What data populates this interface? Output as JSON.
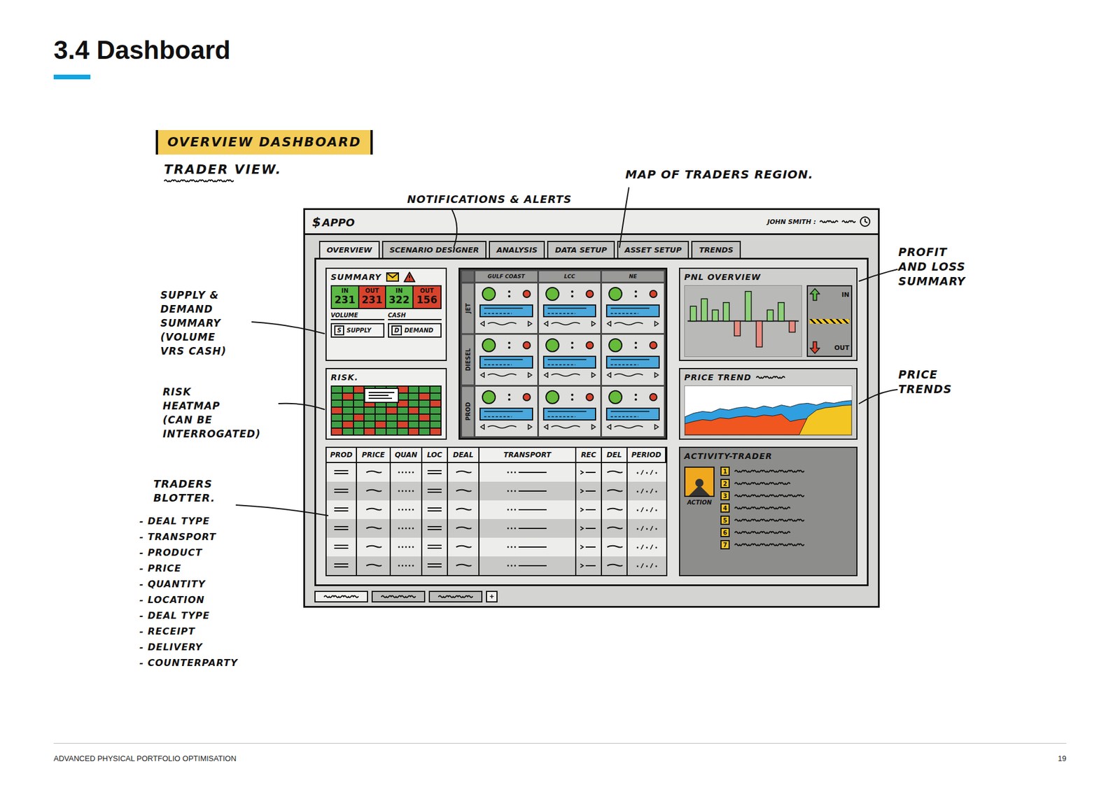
{
  "document": {
    "section_title": "3.4 Dashboard",
    "footer_title": "ADVANCED PHYSICAL PORTFOLIO OPTIMISATION",
    "page_number": "19"
  },
  "sketch": {
    "title": "OVERVIEW DASHBOARD",
    "subtitle": "TRADER VIEW."
  },
  "annotations": {
    "notifications": [
      "NOTIFICATIONS & ALERTS"
    ],
    "map": [
      "MAP OF TRADERS REGION."
    ],
    "pnl": [
      "PROFIT",
      "AND LOSS",
      "SUMMARY"
    ],
    "price": [
      "PRICE",
      "TRENDS"
    ],
    "supply": [
      "SUPPLY &",
      "DEMAND",
      "SUMMARY",
      "(VOLUME",
      "VRS CASH)"
    ],
    "risk": [
      "RISK",
      "HEATMAP",
      "(CAN BE",
      "INTERROGATED)"
    ],
    "blotter": [
      "TRADERS",
      "BLOTTER."
    ],
    "blotter_fields": [
      "- DEAL TYPE",
      "- TRANSPORT",
      "- PRODUCT",
      "- PRICE",
      "- QUANTITY",
      "- LOCATION",
      "- DEAL TYPE",
      "- RECEIPT",
      "- DELIVERY",
      "- COUNTERPARTY"
    ]
  },
  "app": {
    "logo_glyph": "$",
    "name": "APPO",
    "user": "JOHN SMITH :",
    "tabs": [
      {
        "label": "OVERVIEW",
        "selected": true
      },
      {
        "label": "SCENARIO DESIGNER",
        "selected": false
      },
      {
        "label": "ANALYSIS",
        "selected": false
      },
      {
        "label": "DATA SETUP",
        "selected": false
      },
      {
        "label": "ASSET SETUP",
        "selected": false
      },
      {
        "label": "TRENDS",
        "selected": false
      }
    ],
    "summary": {
      "title": "SUMMARY",
      "tiles": [
        {
          "label": "IN",
          "value": "231",
          "color": "#5cb946"
        },
        {
          "label": "OUT",
          "value": "231",
          "color": "#d9432c"
        },
        {
          "label": "IN",
          "value": "322",
          "color": "#5cb946"
        },
        {
          "label": "OUT",
          "value": "156",
          "color": "#d9432c"
        }
      ],
      "measures": [
        "VOLUME",
        "CASH"
      ],
      "legend": [
        {
          "key": "S",
          "label": "SUPPLY"
        },
        {
          "key": "D",
          "label": "DEMAND"
        }
      ]
    },
    "risk": {
      "title": "RISK.",
      "cells": [
        [
          0,
          0,
          1,
          0,
          0,
          0,
          1,
          0,
          0,
          0
        ],
        [
          0,
          1,
          0,
          0,
          1,
          0,
          0,
          0,
          1,
          0
        ],
        [
          0,
          0,
          0,
          1,
          0,
          0,
          1,
          0,
          0,
          1
        ],
        [
          1,
          0,
          0,
          0,
          0,
          1,
          0,
          1,
          0,
          0
        ],
        [
          0,
          0,
          1,
          0,
          0,
          0,
          0,
          0,
          1,
          0
        ],
        [
          0,
          1,
          0,
          0,
          1,
          0,
          1,
          0,
          0,
          0
        ],
        [
          1,
          0,
          0,
          1,
          0,
          0,
          0,
          1,
          0,
          1
        ]
      ]
    },
    "map": {
      "columns": [
        "GULF COAST",
        "LCC",
        "NE"
      ],
      "rows": [
        {
          "label": "JET",
          "cells": [
            {
              "color": "#66bb3a",
              "alert_color": "#d9432c"
            },
            {
              "color": "#66bb3a",
              "alert_color": "#d9432c"
            },
            {
              "color": "#66bb3a",
              "alert_color": "#d9432c"
            }
          ]
        },
        {
          "label": "DIESEL",
          "cells": [
            {
              "color": "#66bb3a",
              "alert_color": "#d9432c"
            },
            {
              "color": "#66bb3a",
              "alert_color": "#d9432c"
            },
            {
              "color": "#66bb3a",
              "alert_color": "#d9432c"
            }
          ]
        },
        {
          "label": "PROD",
          "cells": [
            {
              "color": "#66bb3a",
              "alert_color": "#d9432c"
            },
            {
              "color": "#66bb3a",
              "alert_color": "#d9432c"
            },
            {
              "color": "#66bb3a",
              "alert_color": "#d9432c"
            }
          ]
        }
      ]
    },
    "pnl": {
      "title": "PNL OVERVIEW",
      "values": [
        4,
        6,
        3,
        5,
        -4,
        8,
        -7,
        3,
        5,
        -3
      ],
      "in_label": "IN",
      "out_label": "OUT"
    },
    "price_trend": {
      "title": "PRICE TREND",
      "series": [
        {
          "color": "#2f9fe0",
          "values": [
            40,
            48,
            52,
            50,
            58,
            55,
            60,
            62,
            58,
            64,
            60,
            66,
            62,
            68,
            70,
            66,
            72,
            70,
            74,
            76
          ]
        },
        {
          "color": "#f0561f",
          "values": [
            25,
            30,
            34,
            32,
            38,
            36,
            40,
            42,
            40,
            44,
            42,
            46,
            30,
            34,
            36,
            48,
            50,
            52,
            54,
            56
          ]
        },
        {
          "color": "#f3c623",
          "values": [
            0,
            0,
            0,
            0,
            0,
            0,
            0,
            0,
            0,
            0,
            0,
            0,
            0,
            0,
            40,
            55,
            60,
            62,
            65,
            66
          ]
        }
      ]
    },
    "activity": {
      "title": "ACTIVITY-TRADER",
      "avatar_label": "ACTION",
      "items": [
        {
          "number": "1"
        },
        {
          "number": "2"
        },
        {
          "number": "3"
        },
        {
          "number": "4"
        },
        {
          "number": "5"
        },
        {
          "number": "6"
        },
        {
          "number": "7"
        }
      ]
    },
    "blotter": {
      "columns": [
        "PROD",
        "PRICE",
        "QUAN",
        "LOC",
        "DEAL",
        "TRANSPORT",
        "REC",
        "DEL",
        "PERIOD"
      ],
      "rows": [
        [
          "double",
          "dash",
          "dots",
          "double",
          "dash",
          "dotline",
          "arrowdash",
          "dash",
          "slashes"
        ],
        [
          "double",
          "dash",
          "dots",
          "double",
          "dash",
          "dotline",
          "arrowdash",
          "dash",
          "slashes"
        ],
        [
          "double",
          "dash",
          "dots",
          "double",
          "dash",
          "dotline",
          "arrowdash",
          "dash",
          "slashes"
        ],
        [
          "double",
          "dash",
          "dots",
          "double",
          "dash",
          "dotline",
          "arrowdash",
          "dash",
          "slashes"
        ],
        [
          "double",
          "dash",
          "dots",
          "double",
          "dash",
          "dotline",
          "arrowdash",
          "dash",
          "slashes"
        ],
        [
          "double",
          "dash",
          "dots",
          "double",
          "dash",
          "dotline",
          "arrowdash",
          "dash",
          "slashes"
        ]
      ]
    },
    "bottom_tabs": [
      {
        "selected": true
      },
      {
        "selected": false
      },
      {
        "selected": false
      }
    ],
    "add_button": "+"
  }
}
